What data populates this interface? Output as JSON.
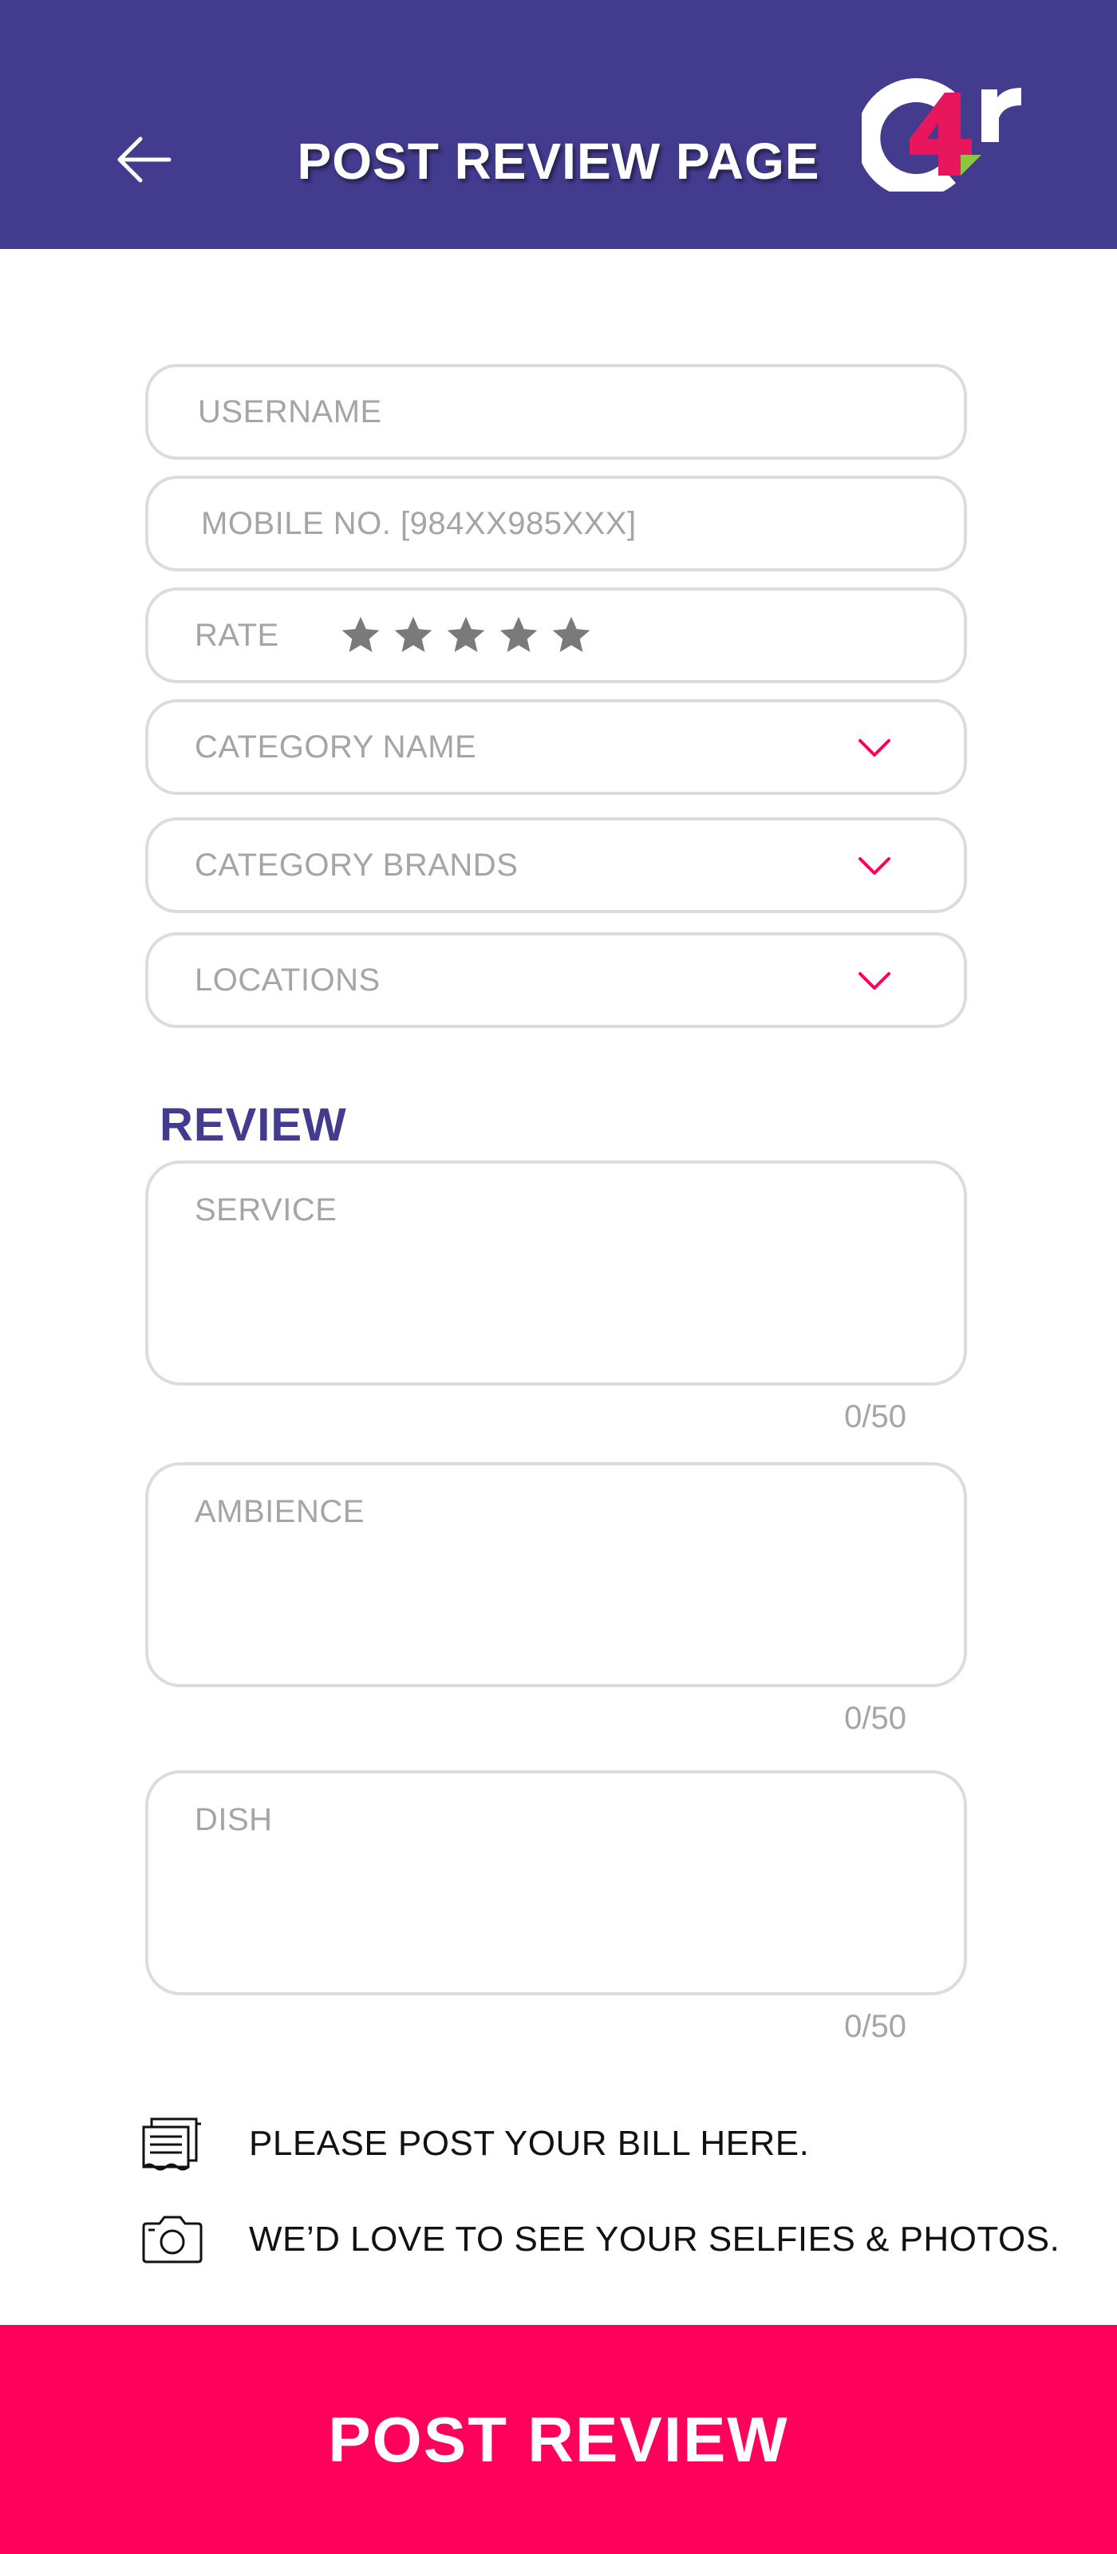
{
  "header": {
    "title": "POST REVIEW PAGE",
    "back_icon": "arrow-left-icon",
    "logo_text": "c4r",
    "background": "#433b8e"
  },
  "form": {
    "username_placeholder": "USERNAME",
    "mobile_placeholder": "MOBILE NO. [984XX985XXX]",
    "rate_label": "RATE",
    "rating": {
      "value": 0,
      "max": 5
    },
    "category_name_placeholder": "CATEGORY NAME",
    "category_brands_placeholder": "CATEGORY BRANDS",
    "locations_placeholder": "LOCATIONS"
  },
  "review": {
    "title": "REVIEW",
    "fields": [
      {
        "placeholder": "SERVICE",
        "counter": "0/50"
      },
      {
        "placeholder": "AMBIENCE",
        "counter": "0/50"
      },
      {
        "placeholder": "DISH",
        "counter": "0/50"
      }
    ]
  },
  "attachments": {
    "bill_text": "PLEASE POST YOUR BILL HERE.",
    "bill_icon": "receipt-icon",
    "photos_text": "WE’D LOVE TO SEE YOUR SELFIES & PHOTOS.",
    "photos_icon": "camera-icon"
  },
  "footer": {
    "post_label": "POST REVIEW"
  },
  "colors": {
    "primary": "#433b8e",
    "accent": "#ff005a",
    "logo_green": "#8dc63f",
    "placeholder": "#a5a5a5",
    "border": "#dcdcdc",
    "star": "#7a7a7a"
  }
}
